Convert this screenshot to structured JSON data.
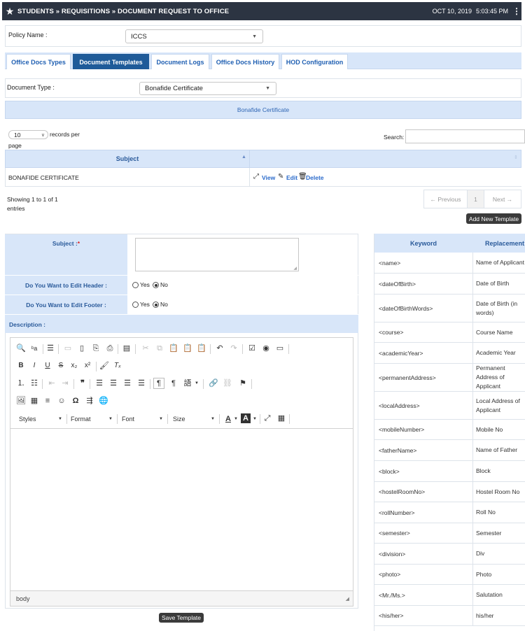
{
  "header": {
    "breadcrumb": "STUDENTS » REQUISITIONS » DOCUMENT REQUEST TO OFFICE",
    "date": "OCT 10, 2019",
    "time": "5:03:45 PM"
  },
  "policy": {
    "label": "Policy Name :",
    "value": "ICCS"
  },
  "tabs": [
    {
      "label": "Office Docs Types"
    },
    {
      "label": "Document Templates"
    },
    {
      "label": "Document Logs"
    },
    {
      "label": "Office Docs History"
    },
    {
      "label": "HOD Configuration"
    }
  ],
  "doc_type": {
    "label": "Document Type :",
    "value": "Bonafide Certificate"
  },
  "banner": "Bonafide Certificate",
  "table": {
    "page_size": "10",
    "records_per_page_a": "records per",
    "records_per_page_b": "page",
    "search_label": "Search:",
    "col_subject": "Subject",
    "row_subject": "BONAFIDE CERTIFICATE",
    "view": "View",
    "edit": "Edit",
    "delete": "Delete",
    "info_a": "Showing 1 to 1 of 1",
    "info_b": "entries",
    "prev": "← Previous",
    "page": "1",
    "next": "Next →",
    "add_button": "Add New Template"
  },
  "form": {
    "subject_label": "Subject :",
    "required_mark": "*",
    "edit_header_label": "Do You Want to Edit Header :",
    "edit_footer_label": "Do You Want to Edit Footer :",
    "yes": "Yes",
    "no": "No",
    "edit_header_value": "No",
    "edit_footer_value": "No",
    "description_label": "Description :",
    "save_button": "Save Template"
  },
  "editor": {
    "styles": "Styles",
    "format": "Format",
    "font": "Font",
    "size": "Size",
    "status_path": "body"
  },
  "keywords": {
    "col_keyword": "Keyword",
    "col_replacement": "Replacement",
    "rows": [
      {
        "k": "<name>",
        "r": "Name of Applicant"
      },
      {
        "k": "<dateOfBirth>",
        "r": "Date of Birth"
      },
      {
        "k": "<dateOfBirthWords>",
        "r": "Date of Birth (in words)"
      },
      {
        "k": "<course>",
        "r": "Course Name"
      },
      {
        "k": "<academicYear>",
        "r": "Academic Year"
      },
      {
        "k": "<permanentAddress>",
        "r": "Permanent Address of Applicant"
      },
      {
        "k": "<localAddress>",
        "r": "Local Address of Applicant"
      },
      {
        "k": "<mobileNumber>",
        "r": "Mobile No"
      },
      {
        "k": "<fatherName>",
        "r": "Name of Father"
      },
      {
        "k": "<block>",
        "r": "Block"
      },
      {
        "k": "<hostelRoomNo>",
        "r": "Hostel Room No"
      },
      {
        "k": "<rollNumber>",
        "r": "Roll No"
      },
      {
        "k": "<semester>",
        "r": "Semester"
      },
      {
        "k": "<division>",
        "r": "Div"
      },
      {
        "k": "<photo>",
        "r": "Photo"
      },
      {
        "k": "<Mr./Ms.>",
        "r": "Salutation"
      },
      {
        "k": "<his/her>",
        "r": "his/her"
      }
    ]
  }
}
